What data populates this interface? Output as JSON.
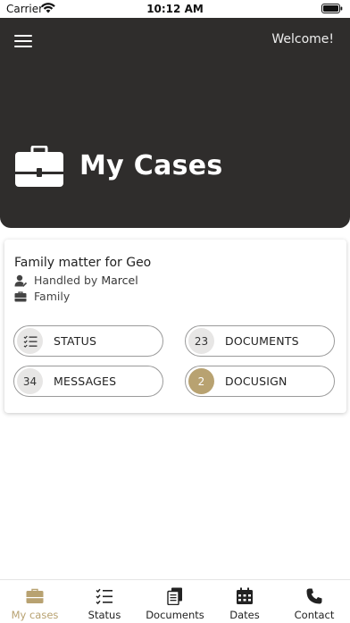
{
  "status_bar": {
    "carrier": "Carrier",
    "time": "10:12 AM"
  },
  "header": {
    "welcome": "Welcome!",
    "title": "My Cases"
  },
  "case": {
    "title": "Family matter for Geo",
    "handled_by_label": "Handled by",
    "handler": "Marcel",
    "category": "Family",
    "actions": [
      {
        "label": "STATUS",
        "badge": "",
        "icon": "checklist-icon"
      },
      {
        "label": "DOCUMENTS",
        "badge": "23"
      },
      {
        "label": "MESSAGES",
        "badge": "34"
      },
      {
        "label": "DOCUSIGN",
        "badge": "2"
      }
    ]
  },
  "tabs": [
    {
      "label": "My cases",
      "icon": "briefcase-icon",
      "active": true
    },
    {
      "label": "Status",
      "icon": "checklist-icon"
    },
    {
      "label": "Documents",
      "icon": "documents-icon"
    },
    {
      "label": "Dates",
      "icon": "calendar-icon"
    },
    {
      "label": "Contact",
      "icon": "phone-icon"
    }
  ],
  "colors": {
    "header_bg": "#2f2d2c",
    "accent_gold": "#b8a271"
  }
}
